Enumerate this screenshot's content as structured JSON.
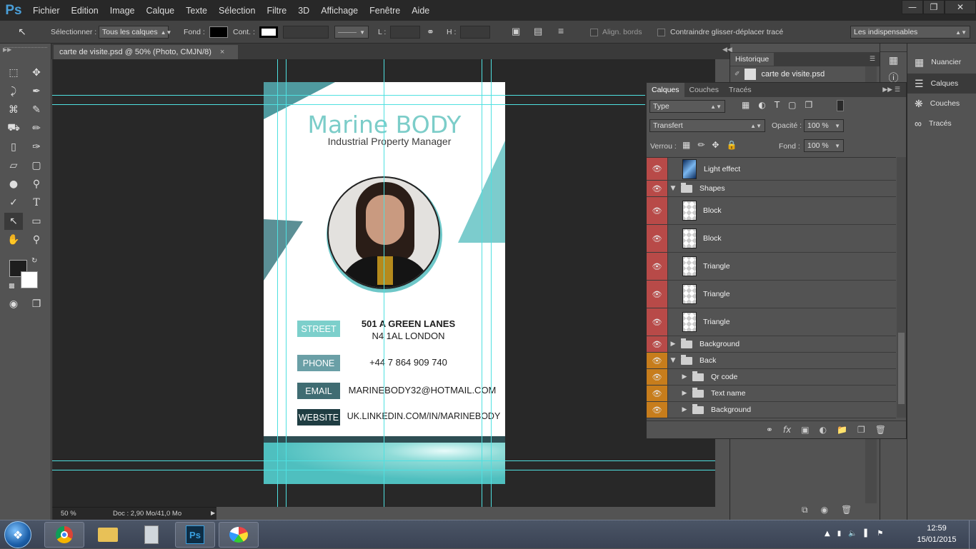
{
  "app": {
    "logo": "Ps",
    "menus": [
      "Fichier",
      "Edition",
      "Image",
      "Calque",
      "Texte",
      "Sélection",
      "Filtre",
      "3D",
      "Affichage",
      "Fenêtre",
      "Aide"
    ],
    "window_controls": [
      "minimize-icon",
      "restore-icon",
      "close-icon"
    ]
  },
  "options": {
    "select_label": "Sélectionner :",
    "select_value": "Tous les calques",
    "fond_label": "Fond :",
    "cont_label": "Cont. :",
    "l_label": "L :",
    "h_label": "H :",
    "align_label": "Align. bords",
    "constrain_label": "Contraindre glisser-déplacer tracé",
    "workspace_value": "Les indispensables"
  },
  "document": {
    "tab_title": "carte de visite.psd @ 50% (Photo, CMJN/8)",
    "zoom": "50 %",
    "doc_info": "Doc : 2,90 Mo/41,0 Mo"
  },
  "card": {
    "name": "Marine BODY",
    "title": "Industrial Property Manager",
    "rows": [
      {
        "label": "STREET",
        "value1": "501 A GREEN LANES",
        "value2": "N4 1AL LONDON",
        "color": "#7ccfcb"
      },
      {
        "label": "PHONE",
        "value1": "+44 7 864 909 740",
        "value2": "",
        "color": "#6a9fa6"
      },
      {
        "label": "EMAIL",
        "value1": "MARINEBODY32@HOTMAIL.COM",
        "value2": "",
        "color": "#3f6c72"
      },
      {
        "label": "WEBSITE",
        "value1": "UK.LINKEDIN.COM/IN/MARINEBODY",
        "value2": "",
        "color": "#1f3d42"
      }
    ],
    "accent": "#5fc4c6"
  },
  "history": {
    "tab": "Historique",
    "item": "carte de visite.psd"
  },
  "dock": {
    "items": [
      "Nuancier",
      "Calques",
      "Couches",
      "Tracés"
    ]
  },
  "layers": {
    "tabs": [
      "Calques",
      "Couches",
      "Tracés"
    ],
    "filter_value": "Type",
    "blend_value": "Transfert",
    "opacity_label": "Opacité :",
    "opacity_value": "100 %",
    "lock_label": "Verrou :",
    "fill_label": "Fond :",
    "fill_value": "100 %",
    "rows": [
      {
        "name": "Light effect",
        "eye": "red"
      },
      {
        "name": "Shapes",
        "eye": "red"
      },
      {
        "name": "Block",
        "eye": "red"
      },
      {
        "name": "Block",
        "eye": "red"
      },
      {
        "name": "Triangle",
        "eye": "red"
      },
      {
        "name": "Triangle",
        "eye": "red"
      },
      {
        "name": "Triangle",
        "eye": "red"
      },
      {
        "name": "Background",
        "eye": "red"
      },
      {
        "name": "Back",
        "eye": "orange"
      },
      {
        "name": "Qr code",
        "eye": "orange"
      },
      {
        "name": "Text name",
        "eye": "orange"
      },
      {
        "name": "Background",
        "eye": "orange"
      }
    ]
  },
  "taskbar": {
    "time": "12:59",
    "date": "15/01/2015",
    "apps": [
      "windows-start-icon",
      "chrome-icon",
      "explorer-icon",
      "calculator-icon",
      "photoshop-icon",
      "paint-icon"
    ]
  },
  "colors": {
    "guide": "#4fe0e0",
    "eye_red": "#b84a48",
    "eye_orange": "#c77d1c"
  }
}
